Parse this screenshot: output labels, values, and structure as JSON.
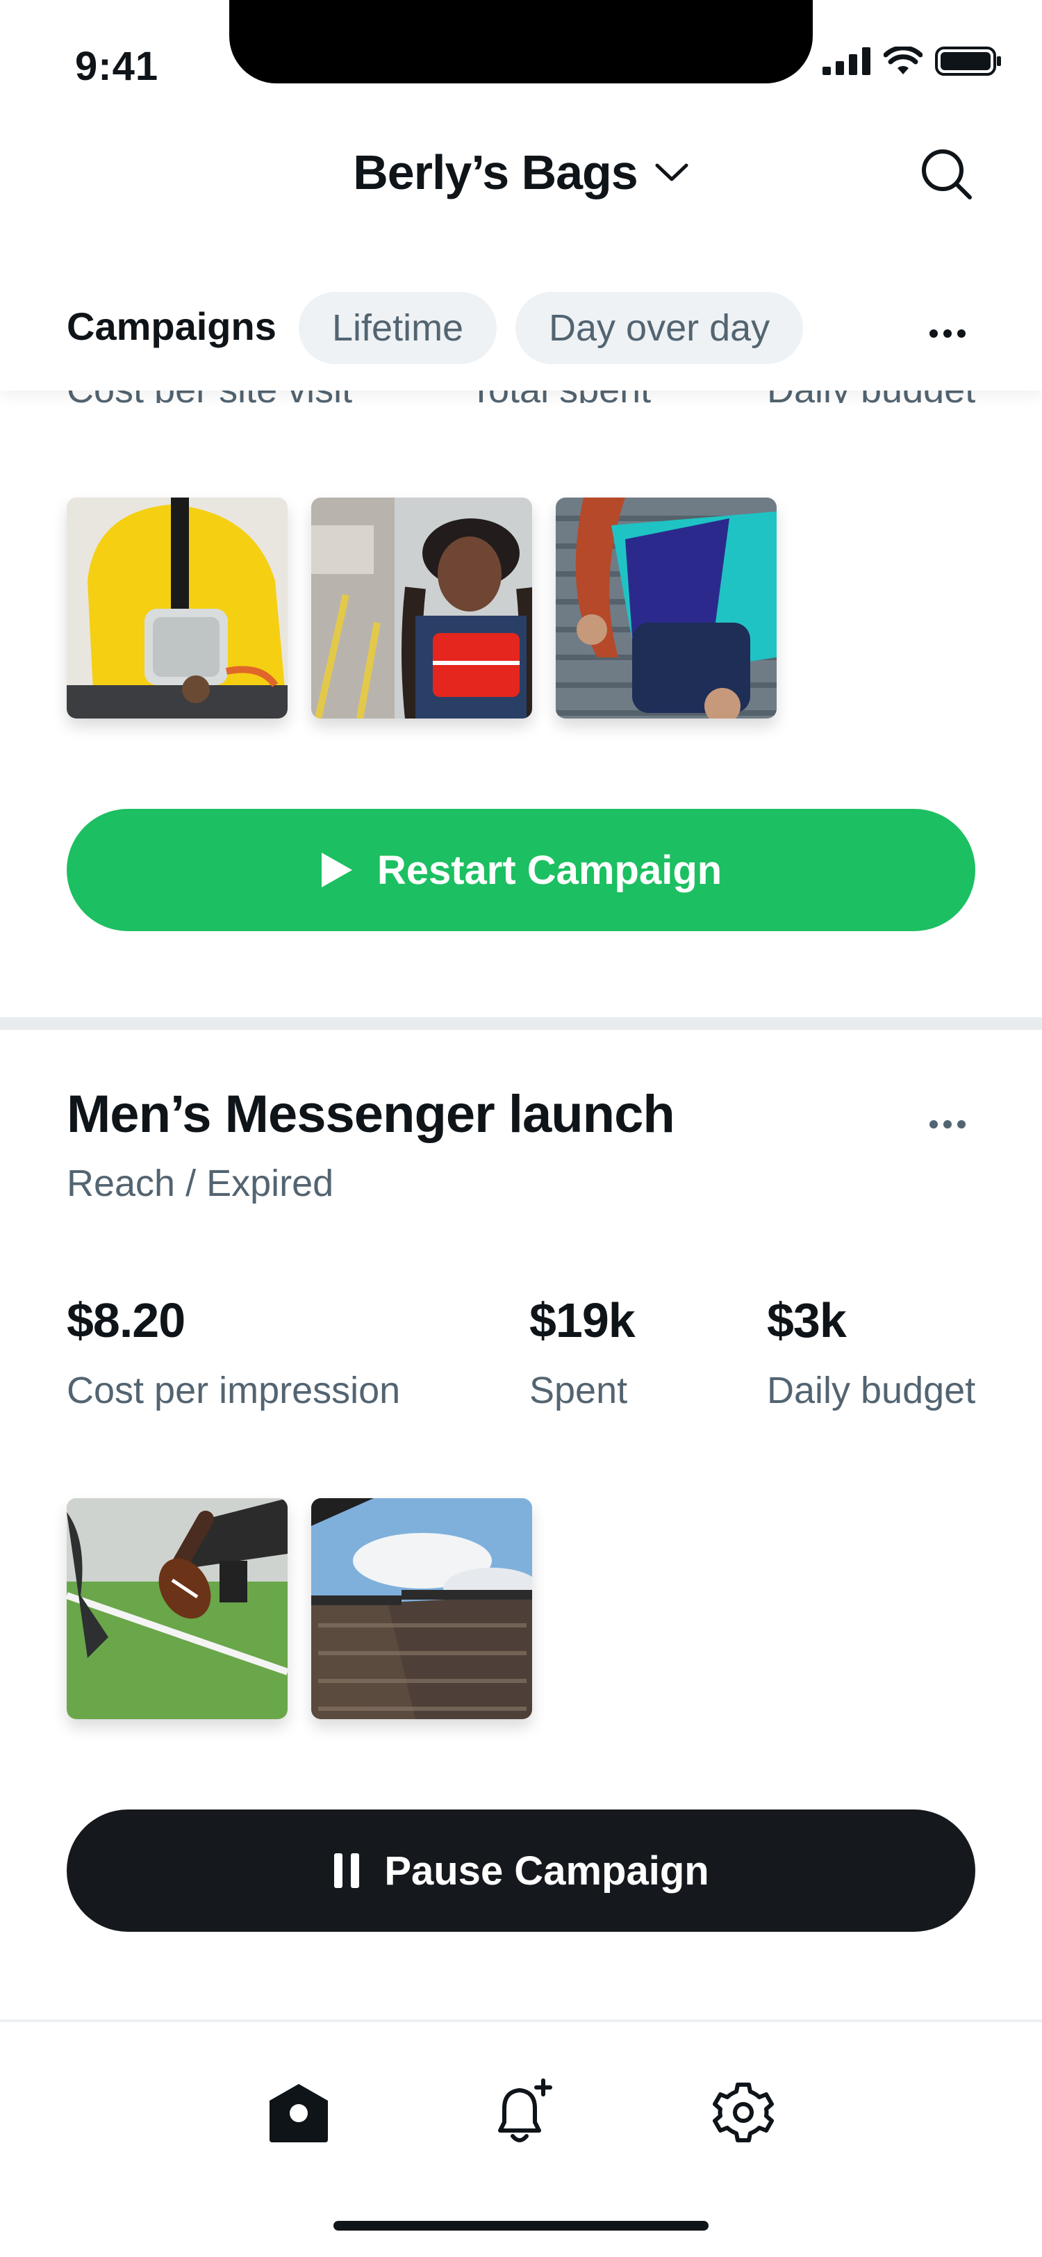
{
  "status_bar": {
    "time": "9:41"
  },
  "header": {
    "brand": "Berly’s Bags"
  },
  "tabs": {
    "title": "Campaigns",
    "chips": [
      "Lifetime",
      "Day over day"
    ]
  },
  "previous_campaign": {
    "stat_labels_partial": [
      "Cost per site visit",
      "Total spent",
      "Daily budget"
    ],
    "cta_label": "Restart Campaign"
  },
  "campaign": {
    "title": "Men’s Messenger launch",
    "subtitle": "Reach / Expired",
    "stats": [
      {
        "value": "$8.20",
        "label": "Cost per impression"
      },
      {
        "value": "$19k",
        "label": "Spent"
      },
      {
        "value": "$3k",
        "label": "Daily budget"
      }
    ],
    "cta_label": "Pause Campaign"
  },
  "colors": {
    "green": "#1cbf61",
    "dark": "#15191e",
    "muted_text": "#536471",
    "chip_bg": "#eef2f5"
  },
  "icons": [
    "signal-icon",
    "wifi-icon",
    "battery-icon",
    "chevron-down-icon",
    "search-icon",
    "more-icon",
    "play-icon",
    "pause-icon",
    "home-icon",
    "bell-plus-icon",
    "gear-icon"
  ]
}
